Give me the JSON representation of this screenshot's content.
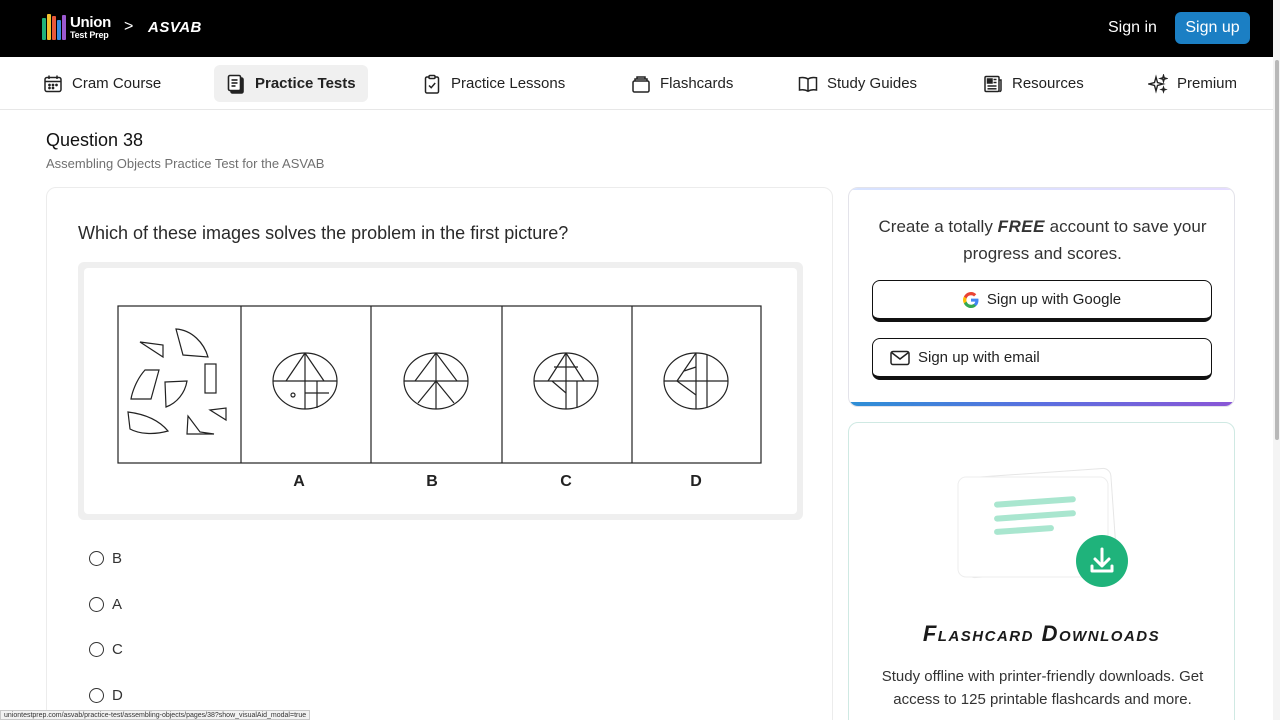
{
  "header": {
    "logo_line1": "Union",
    "logo_line2": "Test Prep",
    "breadcrumb_sep": ">",
    "breadcrumb": "ASVAB",
    "sign_in": "Sign in",
    "sign_up": "Sign up"
  },
  "nav": {
    "items": [
      {
        "label": "Cram Course",
        "icon": "calendar-icon"
      },
      {
        "label": "Practice Tests",
        "icon": "clipboard-pages-icon",
        "active": true
      },
      {
        "label": "Practice Lessons",
        "icon": "clipboard-check-icon"
      },
      {
        "label": "Flashcards",
        "icon": "card-stack-icon"
      },
      {
        "label": "Study Guides",
        "icon": "open-book-icon"
      },
      {
        "label": "Resources",
        "icon": "newspaper-icon"
      },
      {
        "label": "Premium",
        "icon": "sparkles-icon"
      }
    ]
  },
  "question": {
    "title": "Question 38",
    "subtitle": "Assembling Objects Practice Test for the ASVAB",
    "prompt": "Which of these images solves the problem in the first picture?",
    "figure_labels": [
      "A",
      "B",
      "C",
      "D"
    ],
    "options": [
      "B",
      "A",
      "C",
      "D"
    ]
  },
  "signup_card": {
    "text_before": "Create a totally ",
    "text_emphasis": "FREE",
    "text_after": " account to save your progress and scores.",
    "google_button": "Sign up with Google",
    "email_button": "Sign up with email"
  },
  "flash_card": {
    "title": "Flashcard Downloads",
    "description": "Study offline with printer-friendly downloads. Get access to 125 printable flashcards and more."
  },
  "status_url": "uniontestprep.com/asvab/practice-test/assembling-objects/pages/38?show_visualAid_modal=true",
  "colors": {
    "accent_blue": "#1b7fc4",
    "download_green": "#1fb37b"
  }
}
